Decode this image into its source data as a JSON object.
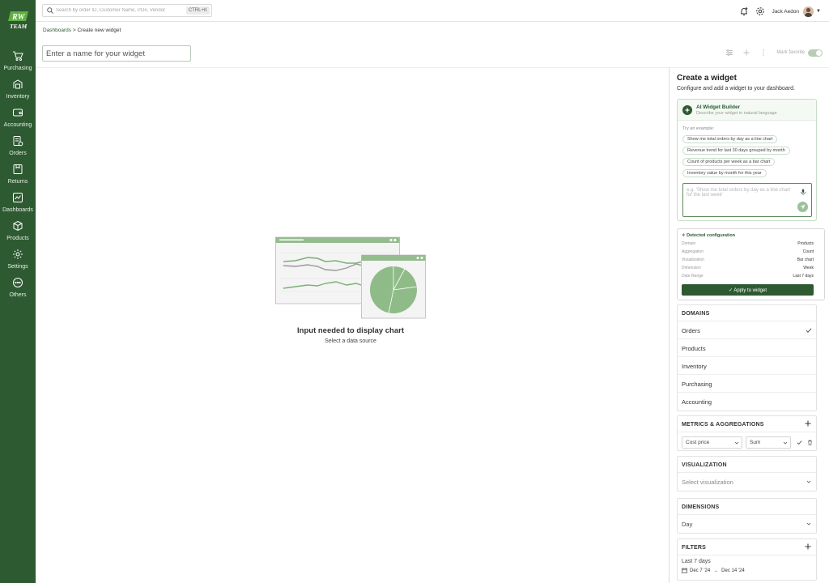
{
  "brand": {
    "logo_text_top": "RW",
    "logo_text_bottom": "TEAM",
    "primary_color": "#2e5a32",
    "accent_light": "#9bc29b"
  },
  "sidebar": {
    "items": [
      {
        "label": "Purchasing",
        "icon": "cart-icon"
      },
      {
        "label": "Inventory",
        "icon": "inventory-icon"
      },
      {
        "label": "Accounting",
        "icon": "wallet-icon"
      },
      {
        "label": "Orders",
        "icon": "orders-icon"
      },
      {
        "label": "Returns",
        "icon": "returns-icon"
      },
      {
        "label": "Dashboards",
        "icon": "dashboard-icon"
      },
      {
        "label": "Products",
        "icon": "box-icon"
      },
      {
        "label": "Settings",
        "icon": "gear-icon"
      },
      {
        "label": "Others",
        "icon": "more-icon"
      }
    ]
  },
  "topbar": {
    "search_placeholder": "Search by order ID, Customer Name, PO#, Vendor",
    "shortcut": "CTRL+K",
    "user_name": "Jack Aedon"
  },
  "breadcrumb": {
    "parent": "Dashboards",
    "separator": ">",
    "current": "Create new widget"
  },
  "header": {
    "name_placeholder": "Enter a name for your widget",
    "favorite_label": "Mark favorite"
  },
  "empty_state": {
    "title": "Input needed to display chart",
    "subtitle": "Select a data source"
  },
  "panel": {
    "title": "Create a widget",
    "subtitle": "Configure and add a widget to your dashboard.",
    "ai": {
      "title": "AI Widget Builder",
      "description": "Describe your widget in natural language",
      "try_label": "Try an example:",
      "examples": [
        "Show me total orders by day as a line chart",
        "Revenue trend for last 30 days grouped by month",
        "Count of products per week as a bar chart",
        "Inventory value by month for this year"
      ],
      "input_placeholder": "e.g. 'Show me total orders by day as a line chart for the last week'"
    },
    "detected": {
      "title": "Detected configuration",
      "rows": [
        {
          "key": "Domain",
          "value": "Products"
        },
        {
          "key": "Aggregation",
          "value": "Count"
        },
        {
          "key": "Visualization",
          "value": "Bar chart"
        },
        {
          "key": "Dimension",
          "value": "Week"
        },
        {
          "key": "Date Range",
          "value": "Last 7 days"
        }
      ],
      "apply_label": "Apply to widget"
    },
    "domains": {
      "title": "DOMAINS",
      "items": [
        "Orders",
        "Products",
        "Inventory",
        "Purchasing",
        "Accounting"
      ],
      "selected": "Orders"
    },
    "metrics": {
      "title": "METRICS & AGGREGATIONS",
      "field": "Cost price",
      "aggregation": "Sum"
    },
    "visualization": {
      "title": "VISUALIZATION",
      "placeholder": "Select visualization"
    },
    "dimensions": {
      "title": "DIMENSIONS",
      "value": "Day"
    },
    "filters": {
      "title": "FILTERS",
      "range_label": "Last 7 days",
      "start": "Dec 7 '24",
      "end": "Dec 14 '24"
    }
  }
}
